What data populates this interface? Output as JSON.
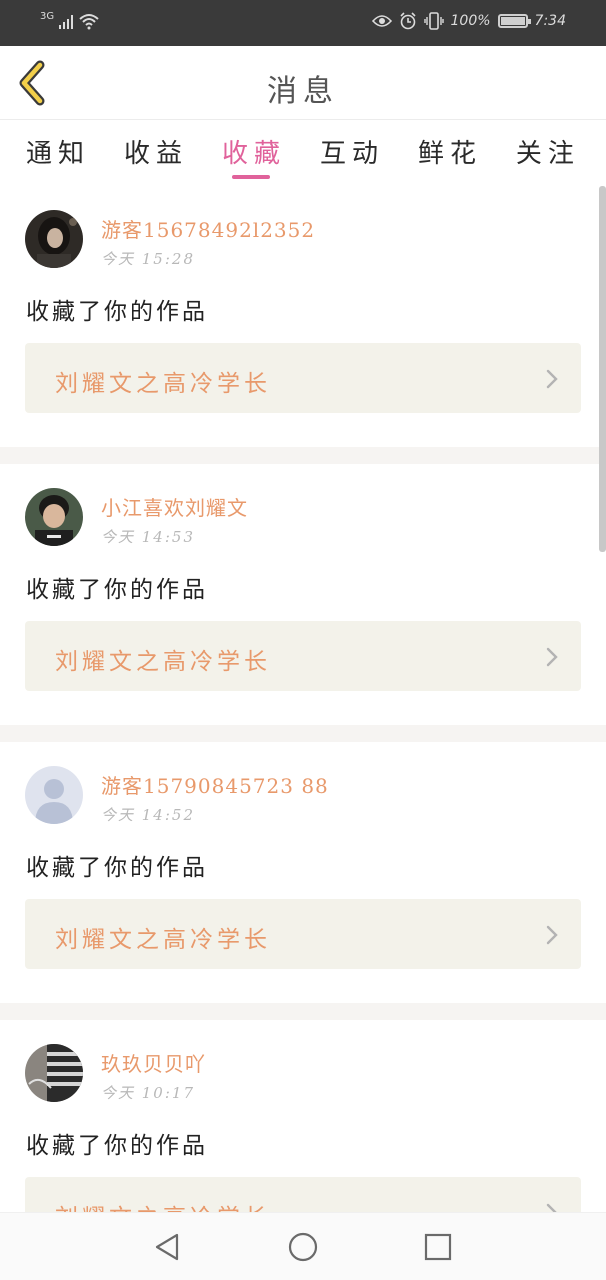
{
  "status_bar": {
    "network": "3G",
    "battery": "100%",
    "time": "7:34"
  },
  "header": {
    "title": "消息"
  },
  "tabs": [
    {
      "label": "通知",
      "active": false
    },
    {
      "label": "收益",
      "active": false
    },
    {
      "label": "收藏",
      "active": true
    },
    {
      "label": "互动",
      "active": false
    },
    {
      "label": "鲜花",
      "active": false
    },
    {
      "label": "关注",
      "active": false
    }
  ],
  "items": [
    {
      "username": "游客15678492l2352",
      "time": "今天  15:28",
      "message": "收藏了你的作品",
      "work_title": "刘耀文之高冷学长",
      "avatar": "photo-dark"
    },
    {
      "username": "小江喜欢刘耀文",
      "time": "今天  14:53",
      "message": "收藏了你的作品",
      "work_title": "刘耀文之高冷学长",
      "avatar": "photo-boy"
    },
    {
      "username": "游客15790845723 88",
      "time": "今天  14:52",
      "message": "收藏了你的作品",
      "work_title": "刘耀文之高冷学长",
      "avatar": "default-avatar"
    },
    {
      "username": "玖玖贝贝吖",
      "time": "今天  10:17",
      "message": "收藏了你的作品",
      "work_title": "刘耀文之高冷学长",
      "avatar": "photo-striped"
    }
  ],
  "colors": {
    "accent": "#e0629b",
    "username": "#e8996b",
    "status_bar": "#3a3a3a",
    "link_bg": "#f3f2ea"
  }
}
